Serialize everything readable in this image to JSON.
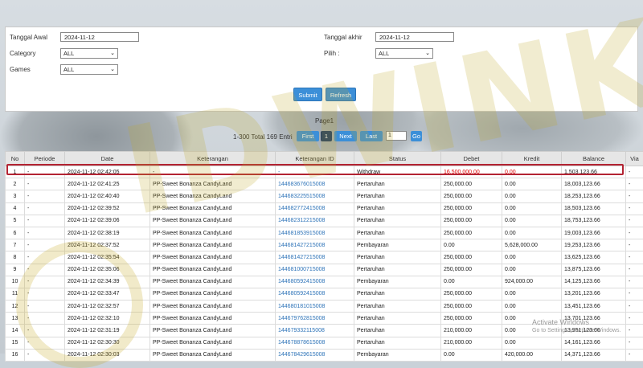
{
  "filters": {
    "start_date_label": "Tanggal Awal",
    "start_date_value": "2024-11-12",
    "end_date_label": "Tanggal akhir",
    "end_date_value": "2024-11-12",
    "category_label": "Category",
    "category_value": "ALL",
    "pilih_label": "Pilih :",
    "pilih_value": "ALL",
    "games_label": "Games",
    "games_value": "ALL",
    "submit_label": "Submit",
    "refresh_label": "Refresh"
  },
  "pager": {
    "page_label": "Page1",
    "info": "1-300 Total 169 Entri",
    "first": "First",
    "current": "1",
    "next": "Next",
    "last": "Last",
    "input_value": "1",
    "go": "Go"
  },
  "table": {
    "headers": [
      "No",
      "Periode",
      "Date",
      "Keterangan",
      "Keterangan ID",
      "Status",
      "Debet",
      "Kredit",
      "Balance",
      "Via"
    ],
    "rows": [
      [
        "1",
        "-",
        "2024-11-12 02:42:05",
        "-",
        "-",
        "Withdraw",
        "16,500,000.00",
        "0.00",
        "1,503,123.66",
        "-"
      ],
      [
        "2",
        "-",
        "2024-11-12 02:41:25",
        "PP-Sweet Bonanza CandyLand",
        "144683676015008",
        "Pertaruhan",
        "250,000.00",
        "0.00",
        "18,003,123.66",
        "-"
      ],
      [
        "3",
        "-",
        "2024-11-12 02:40:40",
        "PP-Sweet Bonanza CandyLand",
        "144683225515008",
        "Pertaruhan",
        "250,000.00",
        "0.00",
        "18,253,123.66",
        "-"
      ],
      [
        "4",
        "-",
        "2024-11-12 02:39:52",
        "PP-Sweet Bonanza CandyLand",
        "144682772415008",
        "Pertaruhan",
        "250,000.00",
        "0.00",
        "18,503,123.66",
        "-"
      ],
      [
        "5",
        "-",
        "2024-11-12 02:39:06",
        "PP-Sweet Bonanza CandyLand",
        "144682312215008",
        "Pertaruhan",
        "250,000.00",
        "0.00",
        "18,753,123.66",
        "-"
      ],
      [
        "6",
        "-",
        "2024-11-12 02:38:19",
        "PP-Sweet Bonanza CandyLand",
        "144681853915008",
        "Pertaruhan",
        "250,000.00",
        "0.00",
        "19,003,123.66",
        "-"
      ],
      [
        "7",
        "-",
        "2024-11-12 02:37:52",
        "PP-Sweet Bonanza CandyLand",
        "144681427215008",
        "Pembayaran",
        "0.00",
        "5,628,000.00",
        "19,253,123.66",
        "-"
      ],
      [
        "8",
        "-",
        "2024-11-12 02:35:54",
        "PP-Sweet Bonanza CandyLand",
        "144681427215008",
        "Pertaruhan",
        "250,000.00",
        "0.00",
        "13,625,123.66",
        "-"
      ],
      [
        "9",
        "-",
        "2024-11-12 02:35:06",
        "PP-Sweet Bonanza CandyLand",
        "144681000715008",
        "Pertaruhan",
        "250,000.00",
        "0.00",
        "13,875,123.66",
        "-"
      ],
      [
        "10",
        "-",
        "2024-11-12 02:34:39",
        "PP-Sweet Bonanza CandyLand",
        "144680592415008",
        "Pembayaran",
        "0.00",
        "924,000.00",
        "14,125,123.66",
        "-"
      ],
      [
        "11",
        "-",
        "2024-11-12 02:33:47",
        "PP-Sweet Bonanza CandyLand",
        "144680592415008",
        "Pertaruhan",
        "250,000.00",
        "0.00",
        "13,201,123.66",
        "-"
      ],
      [
        "12",
        "-",
        "2024-11-12 02:32:57",
        "PP-Sweet Bonanza CandyLand",
        "144680181015008",
        "Pertaruhan",
        "250,000.00",
        "0.00",
        "13,451,123.66",
        "-"
      ],
      [
        "13",
        "-",
        "2024-11-12 02:32:10",
        "PP-Sweet Bonanza CandyLand",
        "144679762815008",
        "Pertaruhan",
        "250,000.00",
        "0.00",
        "13,701,123.66",
        "-"
      ],
      [
        "14",
        "-",
        "2024-11-12 02:31:19",
        "PP-Sweet Bonanza CandyLand",
        "144679332115008",
        "Pertaruhan",
        "210,000.00",
        "0.00",
        "13,951,123.66",
        "-"
      ],
      [
        "15",
        "-",
        "2024-11-12 02:30:30",
        "PP-Sweet Bonanza CandyLand",
        "144678878615008",
        "Pertaruhan",
        "210,000.00",
        "0.00",
        "14,161,123.66",
        "-"
      ],
      [
        "16",
        "-",
        "2024-11-12 02:30:03",
        "PP-Sweet Bonanza CandyLand",
        "144678429615008",
        "Pembayaran",
        "0.00",
        "420,000.00",
        "14,371,123.66",
        "-"
      ]
    ]
  },
  "watermark_text": "IDWINK",
  "overlay": {
    "activate_title": "Activate Windows",
    "activate_sub": "Go to Settings to activate Windows."
  }
}
